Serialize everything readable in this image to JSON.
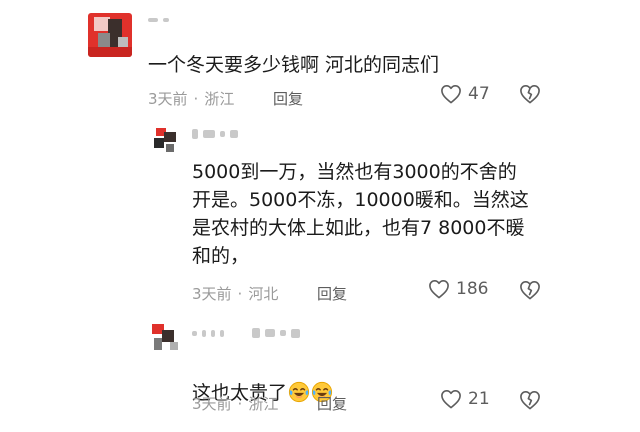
{
  "comments": [
    {
      "username": "",
      "text": "一个冬天要多少钱啊 河北的同志们",
      "time": "3天前",
      "location": "浙江",
      "reply_label": "回复",
      "likes": "47"
    },
    {
      "username": "",
      "text": "5000到一万，当然也有3000的不舍的\n开是。5000不冻，10000暖和。当然这\n是农村的大体上如此，也有7 8000不暖\n和的，",
      "time": "3天前",
      "location": "河北",
      "reply_label": "回复",
      "likes": "186"
    },
    {
      "username": "",
      "text": "这也太贵了",
      "time": "3天前",
      "location": "浙江",
      "reply_label": "回复",
      "likes": "21",
      "emojis": [
        "laughing-crying-emoji",
        "laughing-crying-emoji"
      ]
    }
  ],
  "separator": "·",
  "colors": {
    "text": "#1b1b1b",
    "meta": "#9a9a9a",
    "icon": "#5d5d5d",
    "avatar_red": "#e0312b",
    "avatar_dark": "#3b2f2c"
  },
  "icons": {
    "like": "heart-outline-icon",
    "dislike": "broken-heart-outline-icon"
  }
}
